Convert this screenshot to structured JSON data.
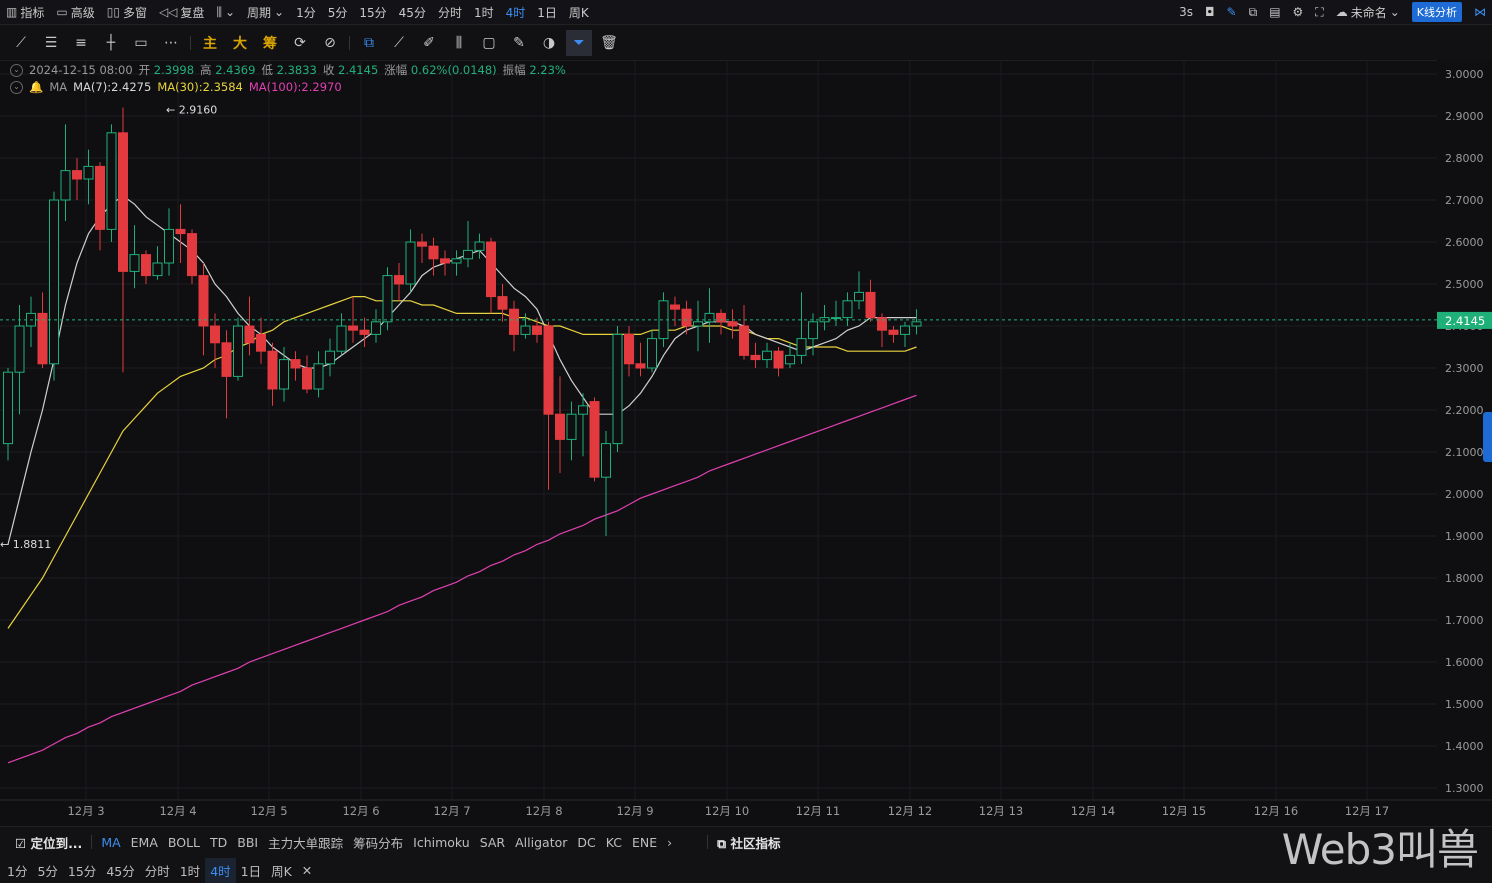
{
  "topbar": {
    "left": [
      "指标",
      "高级",
      "多窗",
      "复盘"
    ],
    "period_label": "周期",
    "intervals": [
      "1分",
      "5分",
      "15分",
      "45分",
      "分时",
      "1时",
      "4时",
      "1日",
      "周K"
    ],
    "active_interval": "4时",
    "refresh": "3s",
    "unnamed": "未命名",
    "kline_btn": "K线分析"
  },
  "toolbar": {
    "main": "主",
    "big": "大",
    "chip": "筹"
  },
  "info": {
    "datetime": "2024-12-15 08:00",
    "open_label": "开",
    "open": "2.3998",
    "high_label": "高",
    "high": "2.4369",
    "low_label": "低",
    "low": "2.3833",
    "close_label": "收",
    "close": "2.4145",
    "change_label": "涨幅",
    "change": "0.62%(0.0148)",
    "amp_label": "振幅",
    "amp": "2.23%"
  },
  "ma_info": {
    "label": "MA",
    "ma7": "MA(7):2.4275",
    "ma30": "MA(30):2.3584",
    "ma100": "MA(100):2.2970"
  },
  "colors": {
    "up": "#1fb07a",
    "down": "#e23a3f",
    "ma7": "#cfcfcf",
    "ma30": "#e8d33c",
    "ma100": "#e040b0",
    "bg": "#0f0f12"
  },
  "chart_data": {
    "type": "candlestick",
    "price_axis": [
      "3.0000",
      "2.9000",
      "2.8000",
      "2.7000",
      "2.6000",
      "2.5000",
      "2.4000",
      "2.3000",
      "2.2000",
      "2.1000",
      "2.0000",
      "1.9000",
      "1.8000",
      "1.7000",
      "1.6000",
      "1.5000",
      "1.4000",
      "1.3000"
    ],
    "ylim": [
      1.29,
      3.01
    ],
    "date_labels": [
      "12月 3",
      "12月 4",
      "12月 5",
      "12月 6",
      "12月 7",
      "12月 8",
      "12月 9",
      "12月 10",
      "12月 11",
      "12月 12",
      "12月 13",
      "12月 14",
      "12月 15",
      "12月 16",
      "12月 17"
    ],
    "last_price": "2.4145",
    "high_marker": "2.9160",
    "low_marker": "1.8811",
    "candles": [
      [
        2.12,
        2.29,
        2.08,
        2.3
      ],
      [
        2.29,
        2.4,
        2.19,
        2.45
      ],
      [
        2.4,
        2.43,
        2.35,
        2.47
      ],
      [
        2.43,
        2.31,
        2.3,
        2.48
      ],
      [
        2.31,
        2.7,
        2.27,
        2.72
      ],
      [
        2.7,
        2.77,
        2.65,
        2.88
      ],
      [
        2.77,
        2.75,
        2.7,
        2.8
      ],
      [
        2.75,
        2.78,
        2.69,
        2.82
      ],
      [
        2.78,
        2.63,
        2.58,
        2.79
      ],
      [
        2.63,
        2.86,
        2.6,
        2.88
      ],
      [
        2.86,
        2.53,
        2.29,
        2.92
      ],
      [
        2.53,
        2.57,
        2.49,
        2.64
      ],
      [
        2.57,
        2.52,
        2.5,
        2.58
      ],
      [
        2.52,
        2.55,
        2.51,
        2.59
      ],
      [
        2.55,
        2.63,
        2.52,
        2.68
      ],
      [
        2.63,
        2.62,
        2.55,
        2.69
      ],
      [
        2.62,
        2.52,
        2.5,
        2.63
      ],
      [
        2.52,
        2.4,
        2.33,
        2.55
      ],
      [
        2.4,
        2.36,
        2.3,
        2.43
      ],
      [
        2.36,
        2.28,
        2.18,
        2.39
      ],
      [
        2.28,
        2.4,
        2.27,
        2.42
      ],
      [
        2.4,
        2.36,
        2.33,
        2.47
      ],
      [
        2.38,
        2.34,
        2.31,
        2.42
      ],
      [
        2.34,
        2.25,
        2.21,
        2.36
      ],
      [
        2.25,
        2.32,
        2.22,
        2.35
      ],
      [
        2.32,
        2.3,
        2.27,
        2.34
      ],
      [
        2.3,
        2.25,
        2.24,
        2.33
      ],
      [
        2.25,
        2.31,
        2.23,
        2.34
      ],
      [
        2.31,
        2.34,
        2.28,
        2.37
      ],
      [
        2.34,
        2.4,
        2.33,
        2.43
      ],
      [
        2.4,
        2.39,
        2.36,
        2.47
      ],
      [
        2.39,
        2.38,
        2.35,
        2.42
      ],
      [
        2.38,
        2.41,
        2.36,
        2.44
      ],
      [
        2.41,
        2.52,
        2.39,
        2.54
      ],
      [
        2.52,
        2.5,
        2.46,
        2.55
      ],
      [
        2.5,
        2.6,
        2.48,
        2.63
      ],
      [
        2.6,
        2.59,
        2.55,
        2.62
      ],
      [
        2.59,
        2.56,
        2.52,
        2.61
      ],
      [
        2.56,
        2.55,
        2.52,
        2.58
      ],
      [
        2.55,
        2.56,
        2.52,
        2.58
      ],
      [
        2.56,
        2.58,
        2.54,
        2.65
      ],
      [
        2.58,
        2.6,
        2.56,
        2.62
      ],
      [
        2.6,
        2.47,
        2.43,
        2.61
      ],
      [
        2.47,
        2.44,
        2.41,
        2.5
      ],
      [
        2.44,
        2.38,
        2.34,
        2.46
      ],
      [
        2.38,
        2.4,
        2.37,
        2.43
      ],
      [
        2.4,
        2.38,
        2.36,
        2.42
      ],
      [
        2.4,
        2.19,
        2.01,
        2.41
      ],
      [
        2.19,
        2.13,
        2.05,
        2.28
      ],
      [
        2.13,
        2.19,
        2.08,
        2.22
      ],
      [
        2.19,
        2.21,
        2.09,
        2.24
      ],
      [
        2.22,
        2.04,
        2.03,
        2.23
      ],
      [
        2.04,
        2.12,
        1.9,
        2.15
      ],
      [
        2.12,
        2.38,
        2.1,
        2.4
      ],
      [
        2.38,
        2.31,
        2.28,
        2.4
      ],
      [
        2.31,
        2.3,
        2.28,
        2.36
      ],
      [
        2.3,
        2.37,
        2.29,
        2.39
      ],
      [
        2.37,
        2.46,
        2.35,
        2.48
      ],
      [
        2.45,
        2.44,
        2.4,
        2.47
      ],
      [
        2.44,
        2.4,
        2.38,
        2.46
      ],
      [
        2.4,
        2.41,
        2.34,
        2.46
      ],
      [
        2.41,
        2.43,
        2.36,
        2.49
      ],
      [
        2.43,
        2.41,
        2.38,
        2.44
      ],
      [
        2.41,
        2.4,
        2.37,
        2.44
      ],
      [
        2.4,
        2.33,
        2.32,
        2.45
      ],
      [
        2.33,
        2.32,
        2.3,
        2.36
      ],
      [
        2.32,
        2.34,
        2.3,
        2.36
      ],
      [
        2.34,
        2.3,
        2.28,
        2.35
      ],
      [
        2.31,
        2.33,
        2.3,
        2.36
      ],
      [
        2.33,
        2.37,
        2.31,
        2.48
      ],
      [
        2.37,
        2.41,
        2.33,
        2.43
      ],
      [
        2.41,
        2.42,
        2.39,
        2.45
      ],
      [
        2.42,
        2.42,
        2.4,
        2.46
      ],
      [
        2.42,
        2.46,
        2.4,
        2.48
      ],
      [
        2.46,
        2.48,
        2.44,
        2.53
      ],
      [
        2.48,
        2.42,
        2.41,
        2.51
      ],
      [
        2.42,
        2.39,
        2.35,
        2.43
      ],
      [
        2.39,
        2.38,
        2.36,
        2.4
      ],
      [
        2.38,
        2.4,
        2.35,
        2.41
      ],
      [
        2.4,
        2.41,
        2.38,
        2.44
      ]
    ],
    "ma7": [
      1.88,
      1.99,
      2.1,
      2.2,
      2.32,
      2.45,
      2.55,
      2.62,
      2.66,
      2.69,
      2.71,
      2.69,
      2.66,
      2.64,
      2.62,
      2.6,
      2.58,
      2.55,
      2.5,
      2.47,
      2.43,
      2.4,
      2.38,
      2.35,
      2.33,
      2.31,
      2.3,
      2.3,
      2.31,
      2.33,
      2.35,
      2.37,
      2.39,
      2.42,
      2.45,
      2.48,
      2.52,
      2.54,
      2.55,
      2.56,
      2.57,
      2.58,
      2.55,
      2.52,
      2.49,
      2.47,
      2.44,
      2.38,
      2.32,
      2.27,
      2.23,
      2.19,
      2.19,
      2.19,
      2.21,
      2.24,
      2.28,
      2.33,
      2.37,
      2.39,
      2.4,
      2.41,
      2.41,
      2.41,
      2.4,
      2.38,
      2.37,
      2.36,
      2.35,
      2.34,
      2.35,
      2.36,
      2.37,
      2.39,
      2.4,
      2.42,
      2.42,
      2.42,
      2.42,
      2.42
    ],
    "ma30": [
      1.68,
      1.72,
      1.76,
      1.8,
      1.85,
      1.9,
      1.95,
      2.0,
      2.05,
      2.1,
      2.15,
      2.18,
      2.21,
      2.24,
      2.26,
      2.28,
      2.29,
      2.3,
      2.32,
      2.33,
      2.35,
      2.36,
      2.38,
      2.39,
      2.41,
      2.42,
      2.43,
      2.44,
      2.45,
      2.46,
      2.47,
      2.47,
      2.46,
      2.46,
      2.46,
      2.46,
      2.45,
      2.45,
      2.44,
      2.43,
      2.43,
      2.43,
      2.43,
      2.43,
      2.42,
      2.42,
      2.41,
      2.4,
      2.4,
      2.39,
      2.38,
      2.38,
      2.38,
      2.38,
      2.38,
      2.38,
      2.39,
      2.39,
      2.39,
      2.4,
      2.4,
      2.4,
      2.4,
      2.39,
      2.39,
      2.38,
      2.37,
      2.37,
      2.36,
      2.35,
      2.35,
      2.35,
      2.35,
      2.34,
      2.34,
      2.34,
      2.34,
      2.34,
      2.34,
      2.35
    ],
    "ma100": [
      1.36,
      1.37,
      1.38,
      1.39,
      1.405,
      1.42,
      1.43,
      1.445,
      1.455,
      1.47,
      1.48,
      1.49,
      1.5,
      1.51,
      1.52,
      1.53,
      1.545,
      1.555,
      1.565,
      1.575,
      1.585,
      1.6,
      1.61,
      1.62,
      1.63,
      1.64,
      1.65,
      1.66,
      1.67,
      1.68,
      1.69,
      1.7,
      1.71,
      1.72,
      1.735,
      1.745,
      1.755,
      1.77,
      1.78,
      1.79,
      1.805,
      1.815,
      1.83,
      1.84,
      1.855,
      1.865,
      1.88,
      1.89,
      1.905,
      1.915,
      1.925,
      1.94,
      1.95,
      1.96,
      1.975,
      1.99,
      2.0,
      2.01,
      2.02,
      2.03,
      2.04,
      2.055,
      2.065,
      2.075,
      2.085,
      2.095,
      2.105,
      2.115,
      2.125,
      2.135,
      2.145,
      2.155,
      2.165,
      2.175,
      2.185,
      2.195,
      2.205,
      2.215,
      2.225,
      2.235
    ]
  },
  "bottom": {
    "locate": "定位到...",
    "indicators": [
      "MA",
      "EMA",
      "BOLL",
      "TD",
      "BBI",
      "主力大单跟踪",
      "筹码分布",
      "Ichimoku",
      "SAR",
      "Alligator",
      "DC",
      "KC",
      "ENE"
    ],
    "community": "社区指标",
    "intervals": [
      "1分",
      "5分",
      "15分",
      "45分",
      "分时",
      "1时",
      "4时",
      "1日",
      "周K"
    ],
    "active_interval": "4时"
  },
  "watermark": "Web3叫兽",
  "watermark_sub": "@Web3叫兽"
}
